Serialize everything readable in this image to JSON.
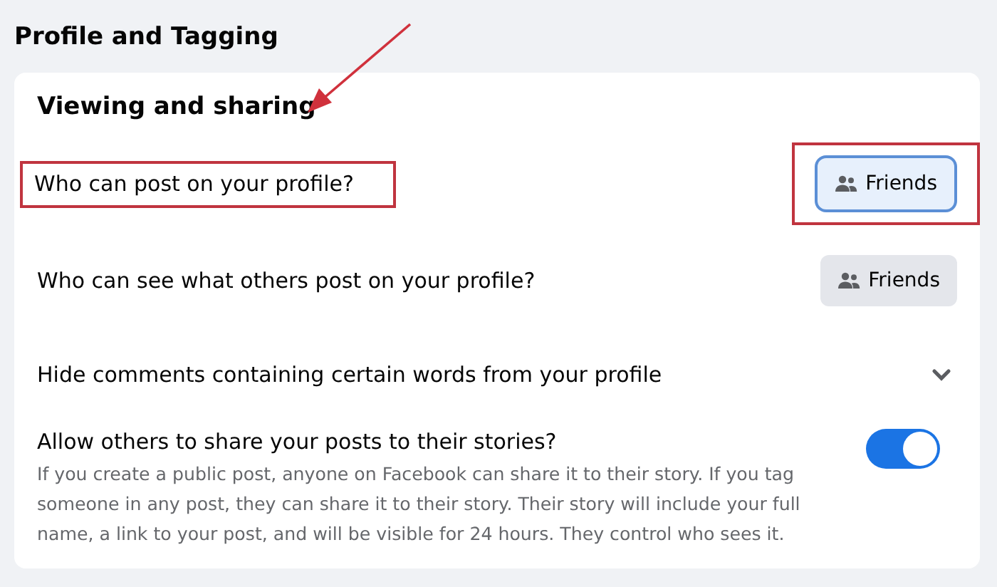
{
  "page_title": "Profile and Tagging",
  "section": {
    "heading": "Viewing and sharing",
    "arrow_pointing": true
  },
  "rows": [
    {
      "kind": "select",
      "label": "Who can post on your profile?",
      "label_annotated": true,
      "button": {
        "label": "Friends",
        "focused": true,
        "annotated": true
      }
    },
    {
      "kind": "select",
      "label": "Who can see what others post on your profile?",
      "label_annotated": false,
      "button": {
        "label": "Friends",
        "focused": false,
        "annotated": false
      }
    },
    {
      "kind": "expand",
      "label": "Hide comments containing certain words from your profile",
      "expanded": false
    },
    {
      "kind": "toggle",
      "label": "Allow others to share your posts to their stories?",
      "description": "If you create a public post, anyone on Facebook can share it to their story. If you tag someone in any post, they can share it to their story. Their story will include your full name, a link to your post, and will be visible for 24 hours. They control who sees it.",
      "on": true
    }
  ]
}
